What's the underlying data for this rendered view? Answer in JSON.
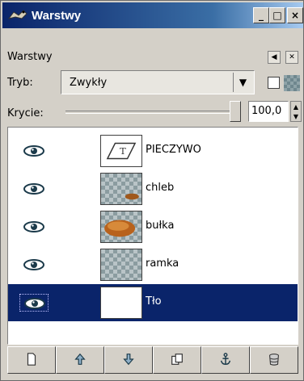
{
  "window": {
    "title": "Warstwy",
    "min_label": "_",
    "max_label": "□",
    "close_label": "×"
  },
  "panel": {
    "label": "Warstwy"
  },
  "mode": {
    "label": "Tryb:",
    "value": "Zwykły"
  },
  "opacity": {
    "label": "Krycie:",
    "value": "100,0",
    "level_percent": 100
  },
  "layers": [
    {
      "name": "PIECZYWO",
      "type": "text",
      "visible": true,
      "selected": false
    },
    {
      "name": "chleb",
      "type": "image",
      "visible": true,
      "selected": false
    },
    {
      "name": "bułka",
      "type": "image",
      "visible": true,
      "selected": false
    },
    {
      "name": "ramka",
      "type": "image",
      "visible": true,
      "selected": false
    },
    {
      "name": "Tło",
      "type": "background",
      "visible": true,
      "selected": true
    }
  ],
  "buttons": [
    {
      "icon": "new-layer-icon"
    },
    {
      "icon": "raise-layer-icon"
    },
    {
      "icon": "lower-layer-icon"
    },
    {
      "icon": "duplicate-layer-icon"
    },
    {
      "icon": "anchor-layer-icon"
    },
    {
      "icon": "delete-layer-icon"
    }
  ],
  "colors": {
    "selection": "#0a246a",
    "title_bar": "#0a246a"
  }
}
